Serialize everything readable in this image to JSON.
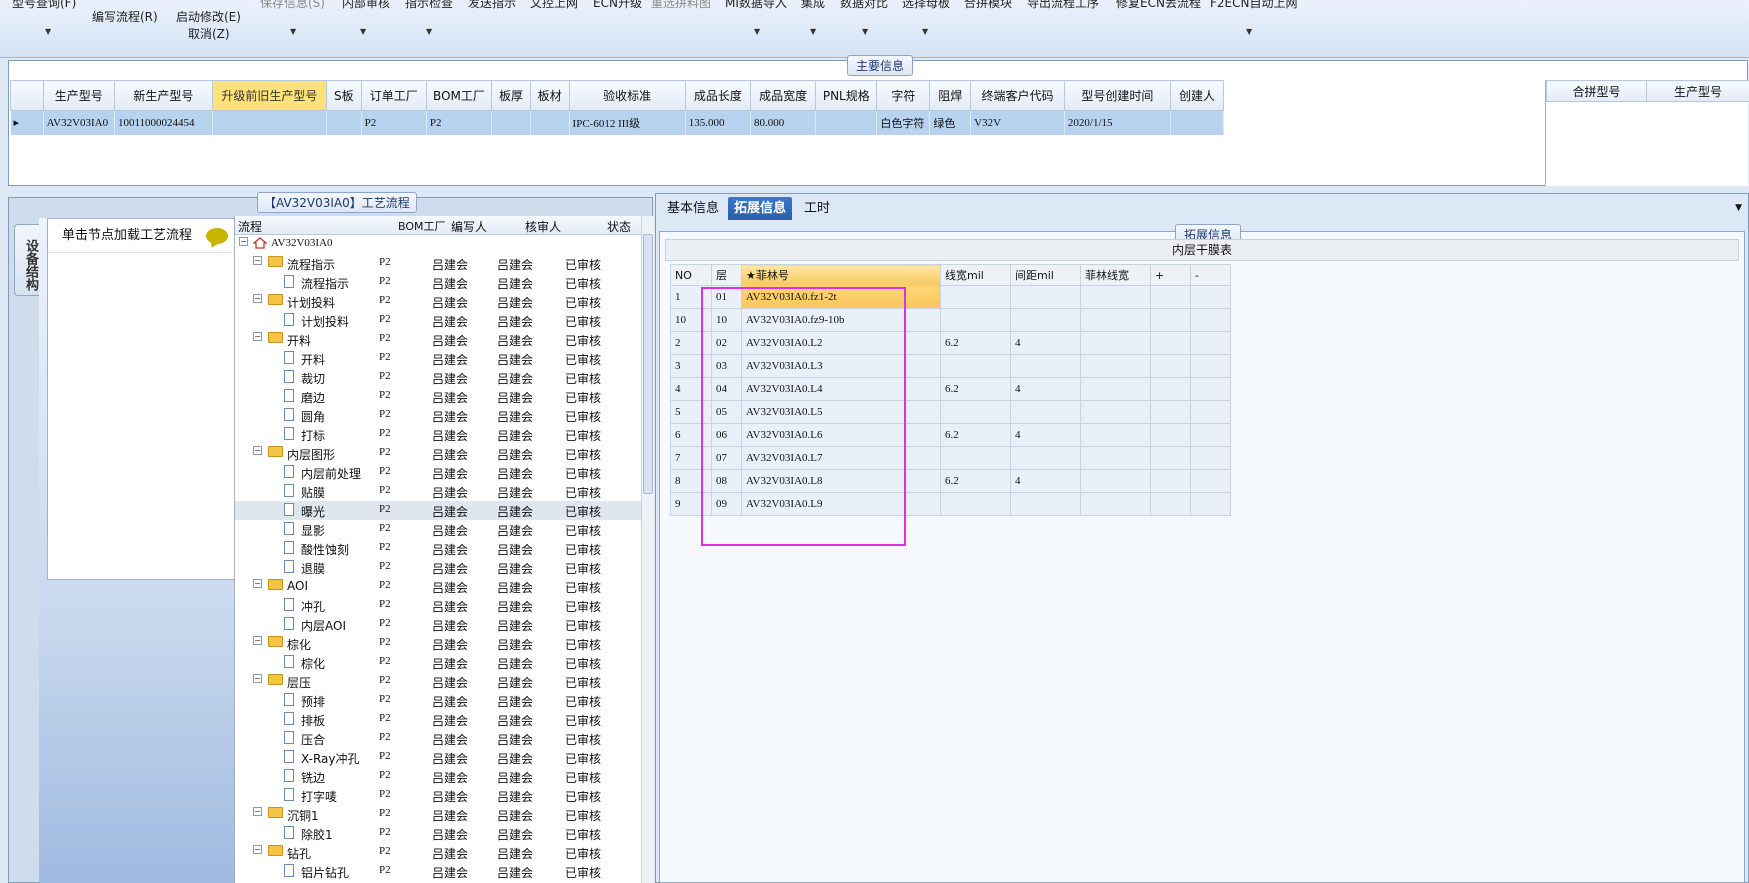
{
  "toolbar": {
    "row1": [
      "型号查询(F)",
      "保存信息(S)",
      "内部审核",
      "指示检查",
      "发送指示",
      "文控上网",
      "ECN升级",
      "重选拼料图",
      "MI数据导入",
      "集成",
      "数据对比",
      "选择母板",
      "合拼模块",
      "导出流程工序",
      "修复ECN丢流程",
      "F2ECN自动上网"
    ],
    "edit_flow": "编写流程(R)",
    "start_modify": "启动修改(E)",
    "cancel": "取消(Z)",
    "dropdown_arrow": "▼"
  },
  "main_info": {
    "caption": "主要信息",
    "columns": [
      "生产型号",
      "新生产型号",
      "升级前旧生产型号",
      "S板",
      "订单工厂",
      "BOM工厂",
      "板厚",
      "板材",
      "验收标准",
      "成品长度",
      "成品宽度",
      "PNL规格",
      "字符",
      "阻焊",
      "终端客户代码",
      "型号创建时间",
      "创建人"
    ],
    "row": [
      "AV32V03IA0",
      "10011000024454",
      "",
      "",
      "P2",
      "P2",
      "",
      "",
      "IPC-6012 III级",
      "135.000",
      "80.000",
      "",
      "白色字符",
      "绿色",
      "V32V",
      "2020/1/15",
      ""
    ],
    "row_marker": "▸",
    "merge_columns": [
      "合拼型号",
      "生产型号"
    ]
  },
  "left_panel": {
    "flow_caption": "【AV32V03IA0】工艺流程",
    "side_tab": "设备结构",
    "load_label": "单击节点加载工艺流程",
    "grid_columns": [
      "流程",
      "BOM工厂",
      "编写人",
      "核审人",
      "状态"
    ],
    "root": "AV32V03IA0",
    "nodes": [
      {
        "name": "流程指示",
        "level": 1
      },
      {
        "name": "流程指示",
        "level": 2
      },
      {
        "name": "计划投料",
        "level": 1
      },
      {
        "name": "计划投料",
        "level": 2
      },
      {
        "name": "开料",
        "level": 1
      },
      {
        "name": "开料",
        "level": 2
      },
      {
        "name": "裁切",
        "level": 2
      },
      {
        "name": "磨边",
        "level": 2
      },
      {
        "name": "圆角",
        "level": 2
      },
      {
        "name": "打标",
        "level": 2
      },
      {
        "name": "内层图形",
        "level": 1
      },
      {
        "name": "内层前处理",
        "level": 2
      },
      {
        "name": "贴膜",
        "level": 2
      },
      {
        "name": "曝光",
        "level": 2,
        "selected": true
      },
      {
        "name": "显影",
        "level": 2
      },
      {
        "name": "酸性蚀刻",
        "level": 2
      },
      {
        "name": "退膜",
        "level": 2
      },
      {
        "name": "AOI",
        "level": 1
      },
      {
        "name": "冲孔",
        "level": 2
      },
      {
        "name": "内层AOI",
        "level": 2
      },
      {
        "name": "棕化",
        "level": 1
      },
      {
        "name": "棕化",
        "level": 2
      },
      {
        "name": "层压",
        "level": 1
      },
      {
        "name": "预排",
        "level": 2
      },
      {
        "name": "排板",
        "level": 2
      },
      {
        "name": "压合",
        "level": 2
      },
      {
        "name": "X-Ray冲孔",
        "level": 2
      },
      {
        "name": "铣边",
        "level": 2
      },
      {
        "name": "打字唛",
        "level": 2
      },
      {
        "name": "沉铜1",
        "level": 1
      },
      {
        "name": "除胶1",
        "level": 2
      },
      {
        "name": "钻孔",
        "level": 1
      },
      {
        "name": "铝片钻孔",
        "level": 2
      }
    ],
    "bom_value": "P2",
    "writer": "吕建会",
    "reviewer": "吕建会",
    "status": "已审核"
  },
  "right_panel": {
    "tabs": [
      "基本信息",
      "拓展信息",
      "工时"
    ],
    "active_tab": 1,
    "ext_caption": "拓展信息",
    "table_title": "内层干膜表",
    "columns": [
      "NO",
      "层",
      "★菲林号",
      "线宽mil",
      "间距mil",
      "菲林线宽",
      "+",
      "-"
    ],
    "rows": [
      [
        "1",
        "01",
        "AV32V03IA0.fz1-2t",
        "",
        "",
        "",
        "",
        ""
      ],
      [
        "10",
        "10",
        "AV32V03IA0.fz9-10b",
        "",
        "",
        "",
        "",
        ""
      ],
      [
        "2",
        "02",
        "AV32V03IA0.L2",
        "6.2",
        "4",
        "",
        "",
        ""
      ],
      [
        "3",
        "03",
        "AV32V03IA0.L3",
        "",
        "",
        "",
        "",
        ""
      ],
      [
        "4",
        "04",
        "AV32V03IA0.L4",
        "6.2",
        "4",
        "",
        "",
        ""
      ],
      [
        "5",
        "05",
        "AV32V03IA0.L5",
        "",
        "",
        "",
        "",
        ""
      ],
      [
        "6",
        "06",
        "AV32V03IA0.L6",
        "6.2",
        "4",
        "",
        "",
        ""
      ],
      [
        "7",
        "07",
        "AV32V03IA0.L7",
        "",
        "",
        "",
        "",
        ""
      ],
      [
        "8",
        "08",
        "AV32V03IA0.L8",
        "6.2",
        "4",
        "",
        "",
        ""
      ],
      [
        "9",
        "09",
        "AV32V03IA0.L9",
        "",
        "",
        "",
        "",
        ""
      ]
    ],
    "collapse_arrow": "▼"
  },
  "colors": {
    "accent_tab": "#2a5ea8",
    "highlight_header": "#ffe17a",
    "selection": "#b7d3f0",
    "annotation_box": "#e030e0"
  }
}
